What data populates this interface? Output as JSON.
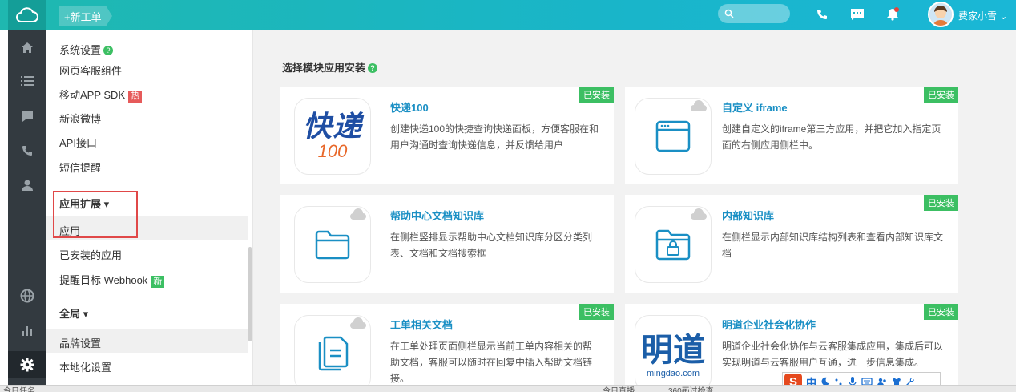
{
  "topbar": {
    "new_ticket": "+新工单",
    "search_placeholder": "",
    "user_name": "费家小雪",
    "user_arrow": "⌄"
  },
  "submenu": {
    "system_settings": "系统设置",
    "items": [
      "网页客服组件",
      "移动APP SDK",
      "新浪微博",
      "API接口",
      "短信提醒"
    ],
    "hot_badge": "热",
    "app_extend": "应用扩展 ▾",
    "app": "应用",
    "installed_apps": "已安装的应用",
    "webhook": "提醒目标 Webhook",
    "new_badge": "新",
    "global": "全局 ▾",
    "brand": "品牌设置",
    "locale": "本地化设置"
  },
  "main": {
    "title": "选择模块应用安装",
    "installed_tag": "已安装",
    "cards": [
      {
        "name": "快递100",
        "desc": "创建快递100的快捷查询快递面板，方便客服在和用户沟通时查询快递信息，并反馈给用户",
        "installed": true,
        "logo": "快递",
        "logo_sub": "100"
      },
      {
        "name": "自定义 iframe",
        "desc": "创建自定义的iframe第三方应用，并把它加入指定页面的右侧应用侧栏中。",
        "installed": true
      },
      {
        "name": "帮助中心文档知识库",
        "desc": "在侧栏竖排显示帮助中心文档知识库分区分类列表、文档和文档搜索框",
        "installed": false
      },
      {
        "name": "内部知识库",
        "desc": "在侧栏显示内部知识库结构列表和查看内部知识库文档",
        "installed": true
      },
      {
        "name": "工单相关文档",
        "desc": "在工单处理页面侧栏显示当前工单内容相关的帮助文档，客服可以随时在回复中插入帮助文档链接。",
        "installed": true
      },
      {
        "name": "明道企业社会化协作",
        "desc": "明道企业社会化协作与云客服集成应用，集成后可以实现明道与云客服用户互通，进一步信息集成。",
        "installed": true,
        "logo": "明道",
        "logo_sub": "mingdao.com"
      }
    ]
  },
  "ime": {
    "logo": "S",
    "mode": "中"
  },
  "statusbar": {
    "left": "今日任务",
    "mid1": "今日直播",
    "mid2": "360画过检查"
  },
  "colors": {
    "accent": "#1fb8b0",
    "sidebar": "#333a40",
    "installed": "#3cbf63",
    "link": "#1a8fc4"
  }
}
